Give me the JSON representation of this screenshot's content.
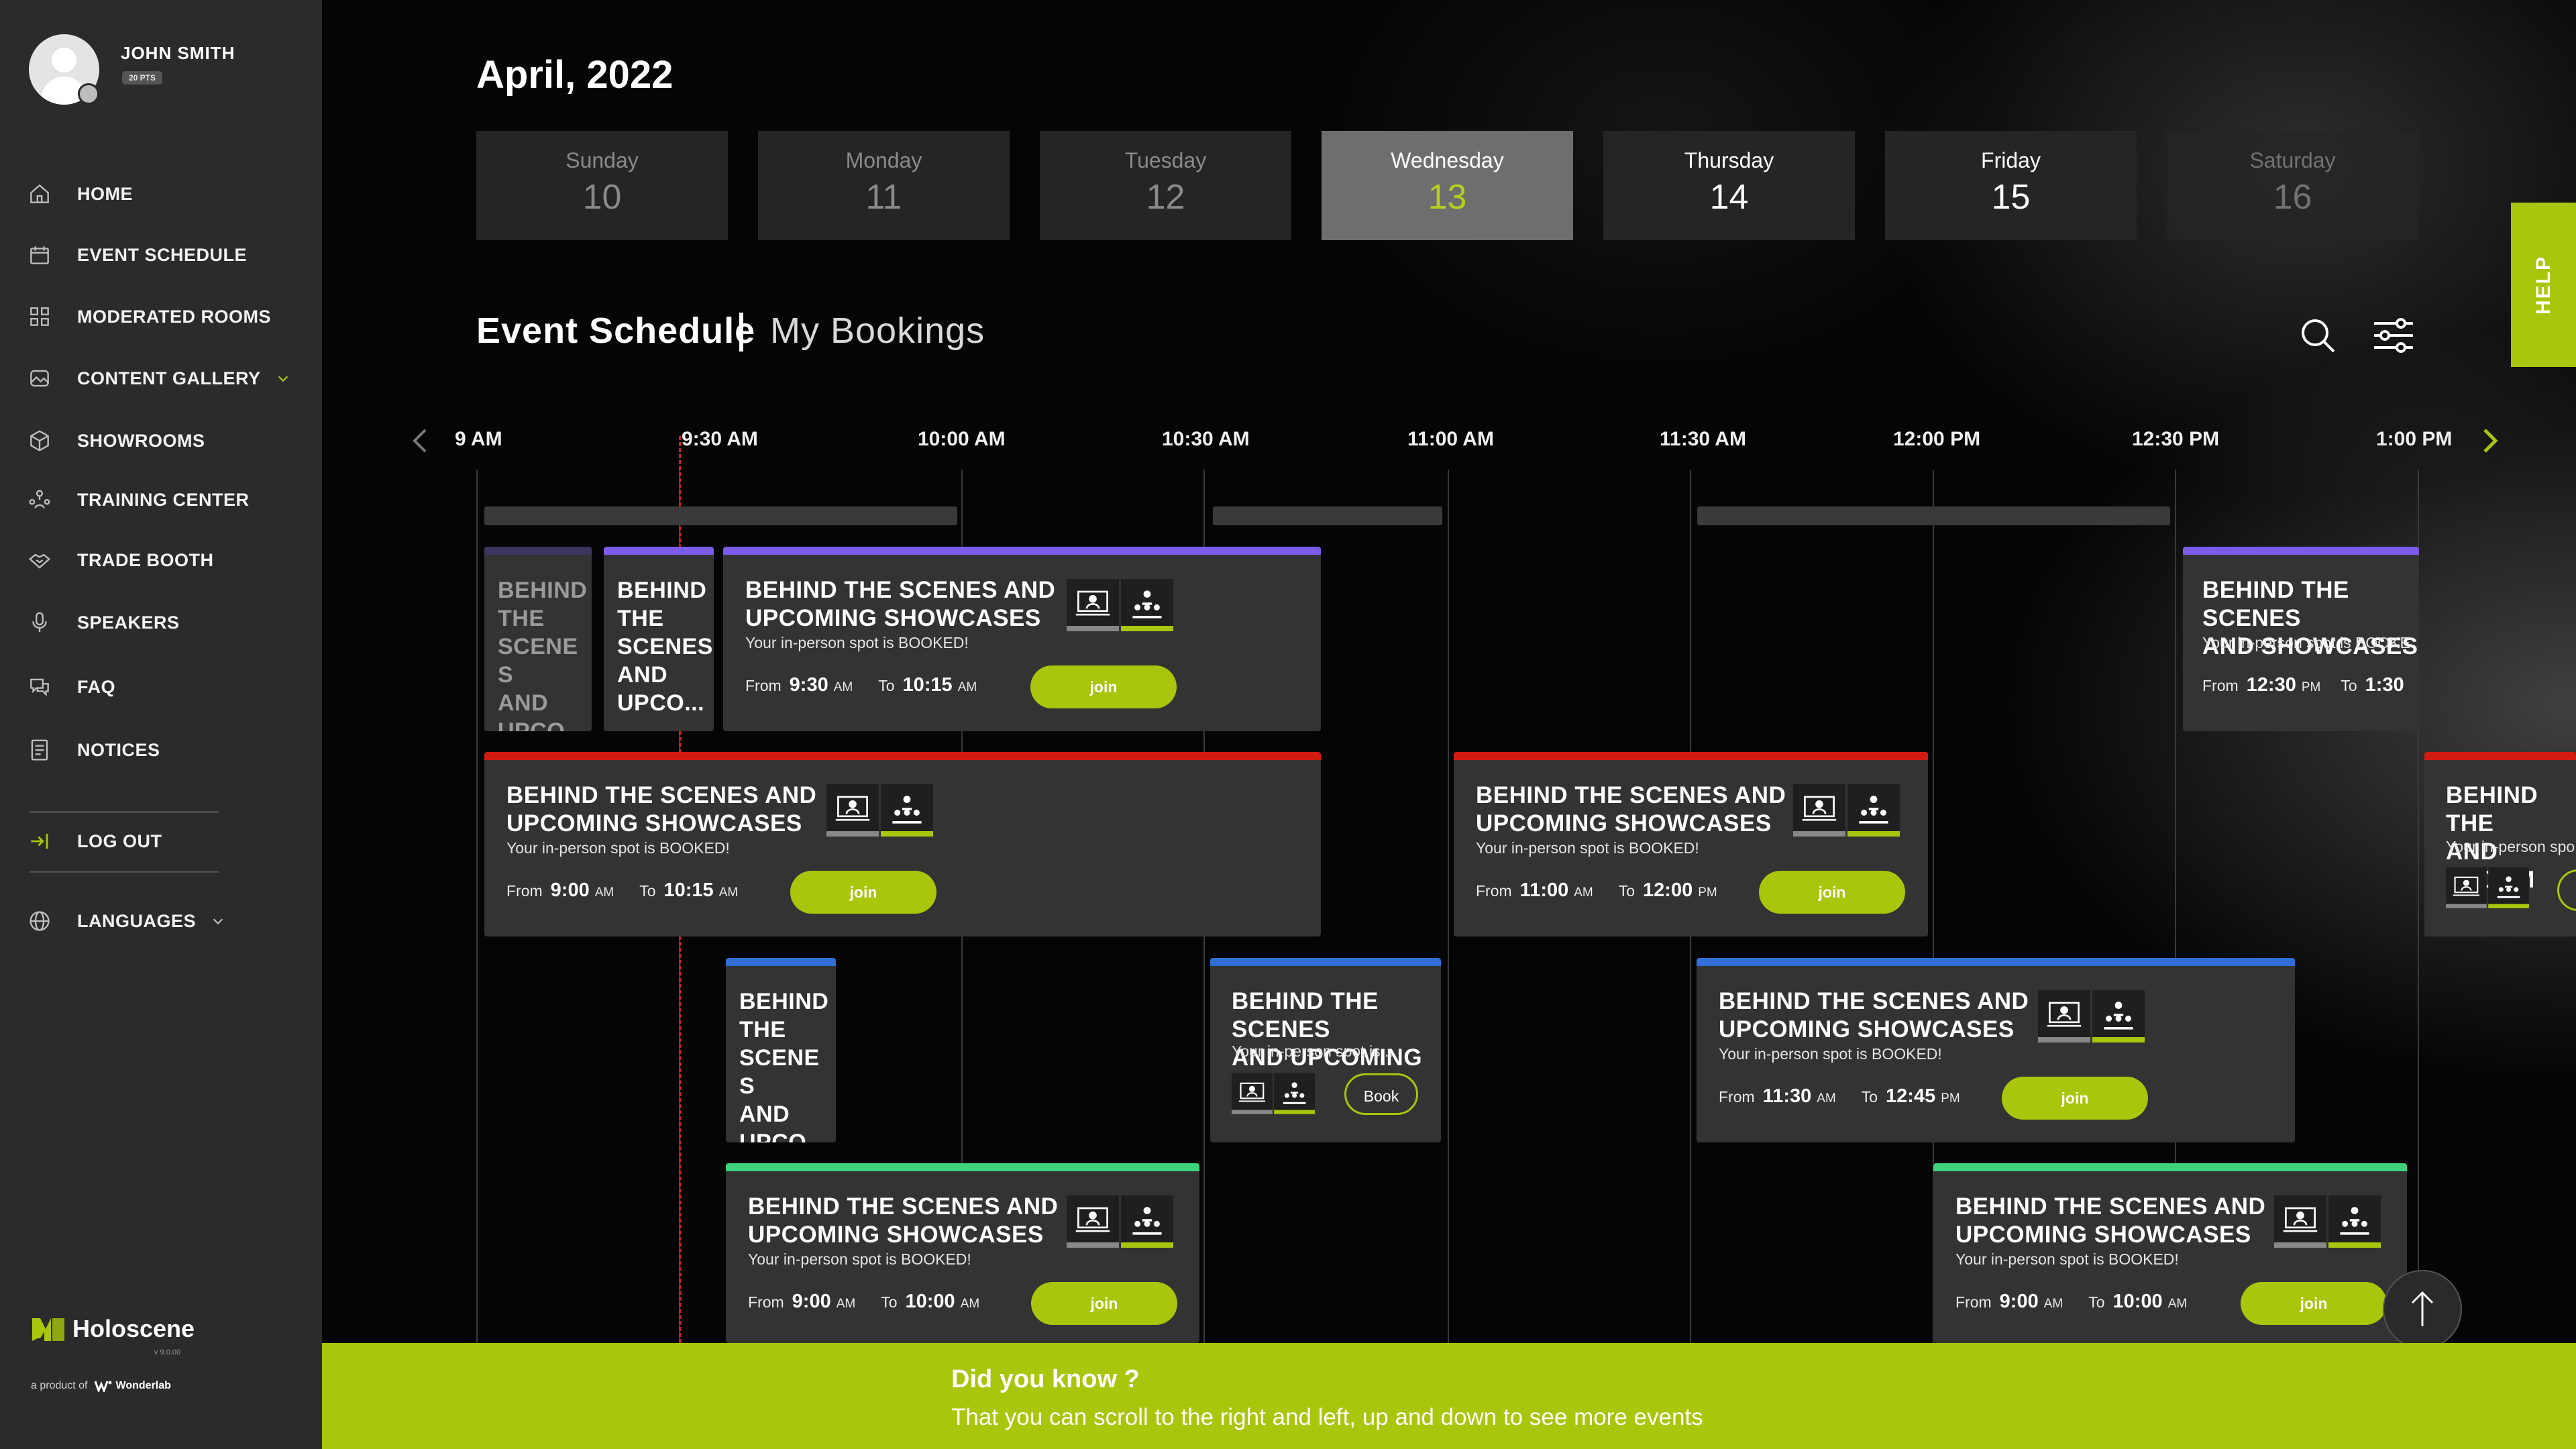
{
  "user": {
    "name": "JOHN SMITH",
    "points": "20 PTS"
  },
  "nav": {
    "home": "HOME",
    "event_schedule": "EVENT SCHEDULE",
    "moderated_rooms": "MODERATED ROOMS",
    "content_gallery": "CONTENT GALLERY",
    "showrooms": "SHOWROOMS",
    "training_center": "TRAINING CENTER",
    "trade_booth": "TRADE BOOTH",
    "speakers": "SPEAKERS",
    "faq": "FAQ",
    "notices": "NOTICES",
    "logout": "LOG OUT",
    "languages": "LANGUAGES"
  },
  "brand": {
    "name": "Holoscene",
    "version": "v 9.0.00",
    "product_of": "a product of",
    "company": "Wonderlab"
  },
  "calendar": {
    "month": "April, 2022",
    "days": [
      {
        "name": "Sunday",
        "num": "10"
      },
      {
        "name": "Monday",
        "num": "11"
      },
      {
        "name": "Tuesday",
        "num": "12"
      },
      {
        "name": "Wednesday",
        "num": "13"
      },
      {
        "name": "Thursday",
        "num": "14"
      },
      {
        "name": "Friday",
        "num": "15"
      },
      {
        "name": "Saturday",
        "num": "16"
      }
    ]
  },
  "tabs": {
    "schedule": "Event Schedule",
    "bookings": "My Bookings"
  },
  "help": "HELP",
  "timeline": [
    "9 AM",
    "9:30 AM",
    "10:00 AM",
    "10:30 AM",
    "11:00 AM",
    "11:30 AM",
    "12:00 PM",
    "12:30 PM",
    "1:00 PM"
  ],
  "colors": {
    "accent": "#a9c50c",
    "purple": "#7b5ce8",
    "red": "#d21b12",
    "blue": "#2f6fd6",
    "green": "#3ed27a",
    "dark_purple": "#3c3560"
  },
  "labels": {
    "from": "From",
    "to": "To",
    "join": "join",
    "book": "Book"
  },
  "events": {
    "e1": {
      "title": "BEHIND\nTHE\nSCENE\nS\nAND\nUPCO"
    },
    "e2": {
      "title": "BEHIND\nTHE\nSCENES\nAND\nUPCO..."
    },
    "e3": {
      "title": "BEHIND THE SCENES AND\nUPCOMING SHOWCASES",
      "status": "Your in-person spot is BOOKED!",
      "from": "9:30",
      "from_ap": "AM",
      "to": "10:15",
      "to_ap": "AM"
    },
    "e4": {
      "title": "BEHIND THE SCENES\nAND SHOWCASES",
      "status": "Your in-person spot is BOOKE",
      "from": "12:30",
      "from_ap": "PM",
      "to": "1:30"
    },
    "e5": {
      "title": "BEHIND THE SCENES AND\nUPCOMING SHOWCASES",
      "status": "Your in-person spot is BOOKED!",
      "from": "9:00",
      "from_ap": "AM",
      "to": "10:15",
      "to_ap": "AM"
    },
    "e6": {
      "title": "BEHIND THE SCENES AND\nUPCOMING SHOWCASES",
      "status": "Your in-person spot is BOOKED!",
      "from": "11:00",
      "from_ap": "AM",
      "to": "12:00",
      "to_ap": "PM"
    },
    "e7": {
      "title": "BEHIND THE\nAND UPCOM",
      "status": "Your in-person spo"
    },
    "e8": {
      "title": "BEHIND\nTHE\nSCENE\nS\nAND\nUPCO"
    },
    "e9": {
      "title": "BEHIND THE SCENES\nAND UPCOMING ...",
      "status": "Your in-person spot is .."
    },
    "e10": {
      "title": "BEHIND THE SCENES AND\nUPCOMING SHOWCASES",
      "status": "Your in-person spot is BOOKED!",
      "from": "11:30",
      "from_ap": "AM",
      "to": "12:45",
      "to_ap": "PM"
    },
    "e11": {
      "title": "BEHIND THE SCENES AND\nUPCOMING SHOWCASES",
      "status": "Your in-person spot is BOOKED!",
      "from": "9:00",
      "from_ap": "AM",
      "to": "10:00",
      "to_ap": "AM"
    },
    "e12": {
      "title": "BEHIND THE SCENES AND\nUPCOMING SHOWCASES",
      "status": "Your in-person spot is BOOKED!",
      "from": "9:00",
      "from_ap": "AM",
      "to": "10:00",
      "to_ap": "AM"
    }
  },
  "tip": {
    "title": "Did you know ?",
    "text": "That you can scroll to the right and left, up and down to see more events"
  }
}
